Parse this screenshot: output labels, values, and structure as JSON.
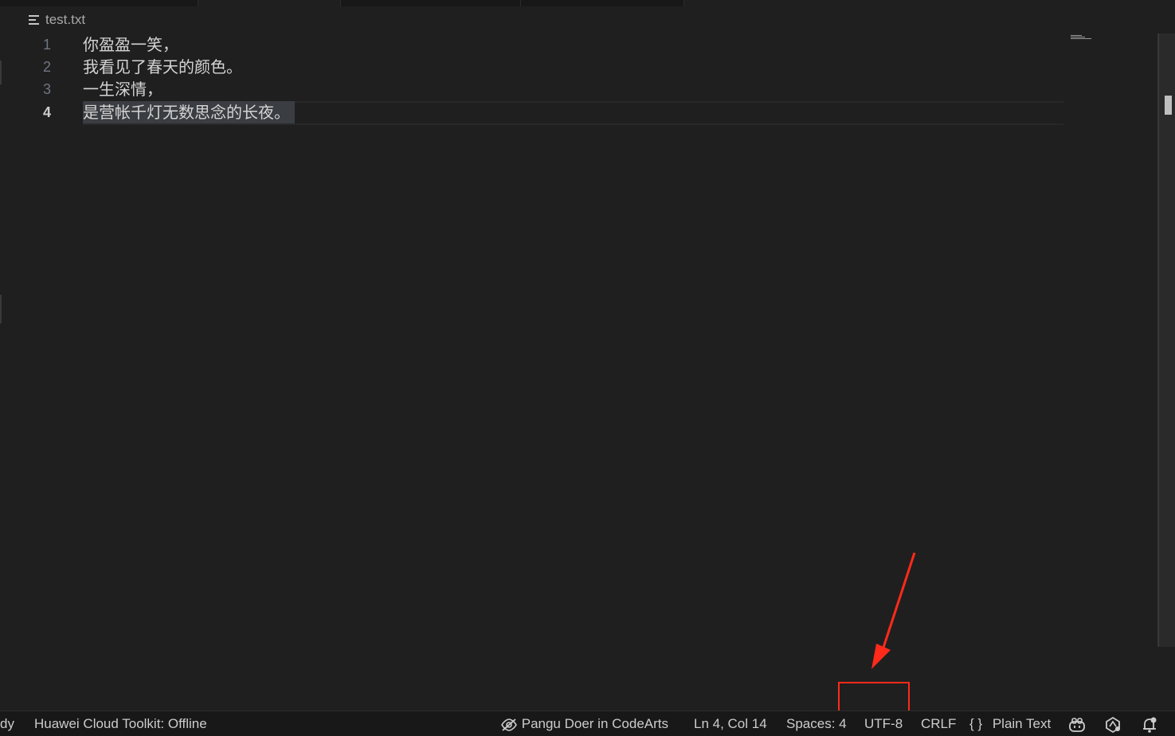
{
  "breadcrumb": {
    "file_icon": "file-lines-icon",
    "file_name": "test.txt"
  },
  "editor": {
    "lines": [
      {
        "number": "1",
        "text": "你盈盈一笑，"
      },
      {
        "number": "2",
        "text": "我看见了春天的颜色。"
      },
      {
        "number": "3",
        "text": "一生深情，"
      },
      {
        "number": "4",
        "text": "是营帐千灯无数思念的长夜。"
      }
    ],
    "current_line": "4"
  },
  "statusbar": {
    "left_partial": "dy",
    "toolkit_status": "Huawei Cloud Toolkit: Offline",
    "pangu_label": "Pangu Doer in CodeArts",
    "pangu_icon": "eye-off-icon",
    "cursor_position": "Ln 4, Col 14",
    "indentation": "Spaces: 4",
    "encoding": "UTF-8",
    "line_ending": "CRLF",
    "language_icon": "{ }",
    "language": "Plain Text",
    "copilot_icon": "copilot-icon",
    "accounts_icon": "spark-icon",
    "notifications_icon": "bell-dot-icon"
  },
  "colors": {
    "annotation": "#ff2a1a",
    "editor_bg": "#1f1f1f",
    "statusbar_bg": "#181818"
  }
}
